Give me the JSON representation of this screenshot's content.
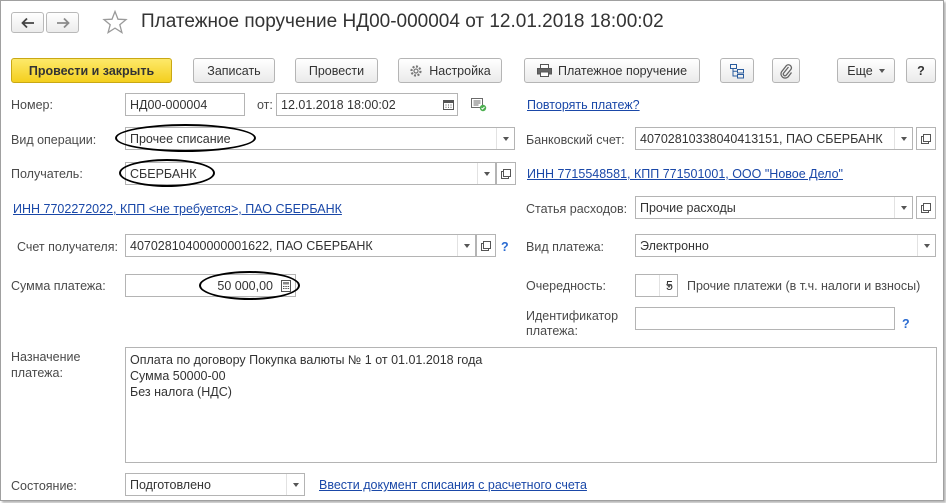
{
  "header": {
    "title": "Платежное поручение НД00-000004 от 12.01.2018 18:00:02"
  },
  "toolbar": {
    "post_close": "Провести и закрыть",
    "save": "Записать",
    "post": "Провести",
    "settings": "Настройка",
    "payment_order": "Платежное поручение",
    "more": "Еще",
    "help": "?"
  },
  "form": {
    "number_label": "Номер:",
    "number_value": "НД00-000004",
    "date_label": "от:",
    "date_value": "12.01.2018 18:00:02",
    "repeat_payment_link": "Повторять платеж?",
    "operation_label": "Вид операции:",
    "operation_value": "Прочее списание",
    "bank_account_label": "Банковский счет:",
    "bank_account_value": "40702810338040413151, ПАО СБЕРБАНК",
    "recipient_label": "Получатель:",
    "recipient_value": "СБЕРБАНК",
    "org_inn_link": "ИНН 7715548581, КПП 771501001, ООО \"Новое Дело\"",
    "recipient_inn_link": "ИНН 7702272022, КПП <не требуется>, ПАО СБЕРБАНК",
    "expense_item_label": "Статья расходов:",
    "expense_item_value": "Прочие расходы",
    "recipient_account_label": "Счет получателя:",
    "recipient_account_value": "40702810400000001622, ПАО СБЕРБАНК",
    "payment_type_label": "Вид платежа:",
    "payment_type_value": "Электронно",
    "amount_label": "Сумма платежа:",
    "amount_value": "50 000,00",
    "priority_label": "Очередность:",
    "priority_value": "5",
    "priority_desc": "Прочие платежи (в т.ч. налоги и взносы)",
    "payment_id_label_1": "Идентификатор",
    "payment_id_label_2": "платежа:",
    "payment_id_value": "",
    "purpose_label_1": "Назначение",
    "purpose_label_2": "платежа:",
    "purpose_lines": [
      "Оплата по договору Покупка валюты № 1 от 01.01.2018 года",
      "Сумма 50000-00",
      "Без налога (НДС)"
    ],
    "status_label": "Состояние:",
    "status_value": "Подготовлено",
    "enter_writeoff_link": "Ввести документ списания с расчетного счета",
    "help_mark": "?"
  },
  "icons": {
    "back": "arrow-left-icon",
    "forward": "arrow-right-icon",
    "favorite": "star-icon",
    "settings": "gear-icon",
    "print": "printer-icon",
    "structure": "structure-icon",
    "attach": "paperclip-icon",
    "calendar": "calendar-icon",
    "calculator": "calculator-icon",
    "open": "open-form-icon"
  },
  "colors": {
    "primary_button": "#f4cf1e",
    "link": "#1a48a8",
    "help": "#2a6bd1"
  }
}
